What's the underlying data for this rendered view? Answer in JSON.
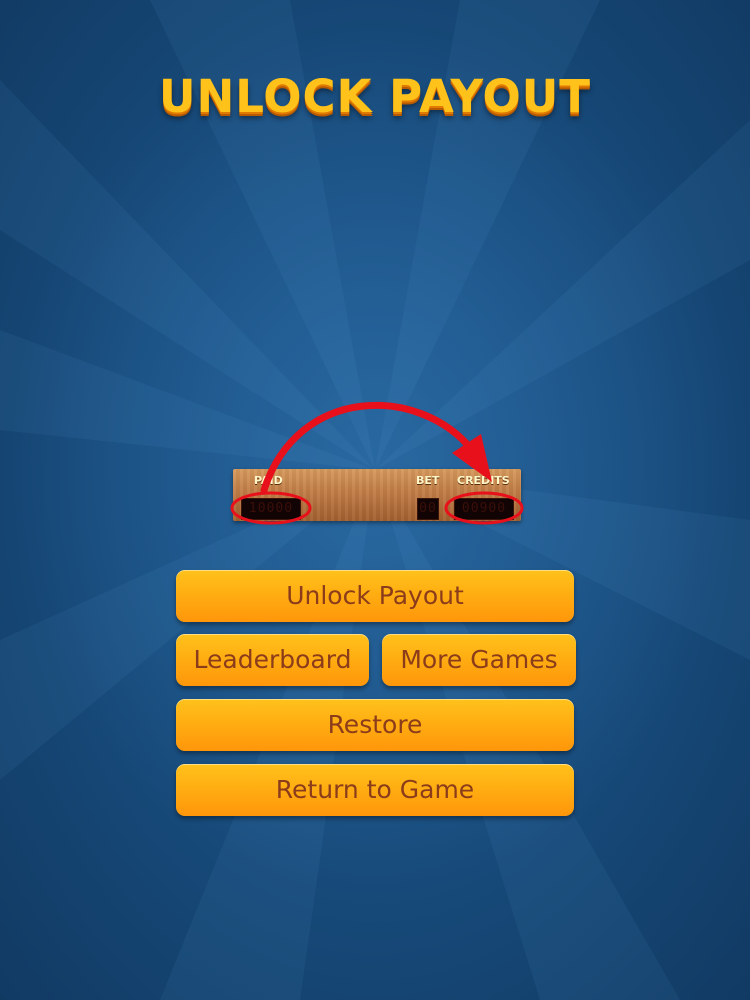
{
  "title": "UNLOCK PAYOUT",
  "panel": {
    "paid_label": "PAID",
    "bet_label": "BET",
    "credits_label": "CREDITS",
    "paid_value": "10000",
    "bet_value": "00",
    "credits_value": "00900"
  },
  "buttons": {
    "unlock": "Unlock Payout",
    "leaderboard": "Leaderboard",
    "more_games": "More Games",
    "restore": "Restore",
    "return": "Return to Game"
  },
  "colors": {
    "background": "#1a4f7f",
    "title": "#ffc21a",
    "button": "#ffae12",
    "button_text": "#8b3c1a",
    "annotation": "#e8101a"
  }
}
